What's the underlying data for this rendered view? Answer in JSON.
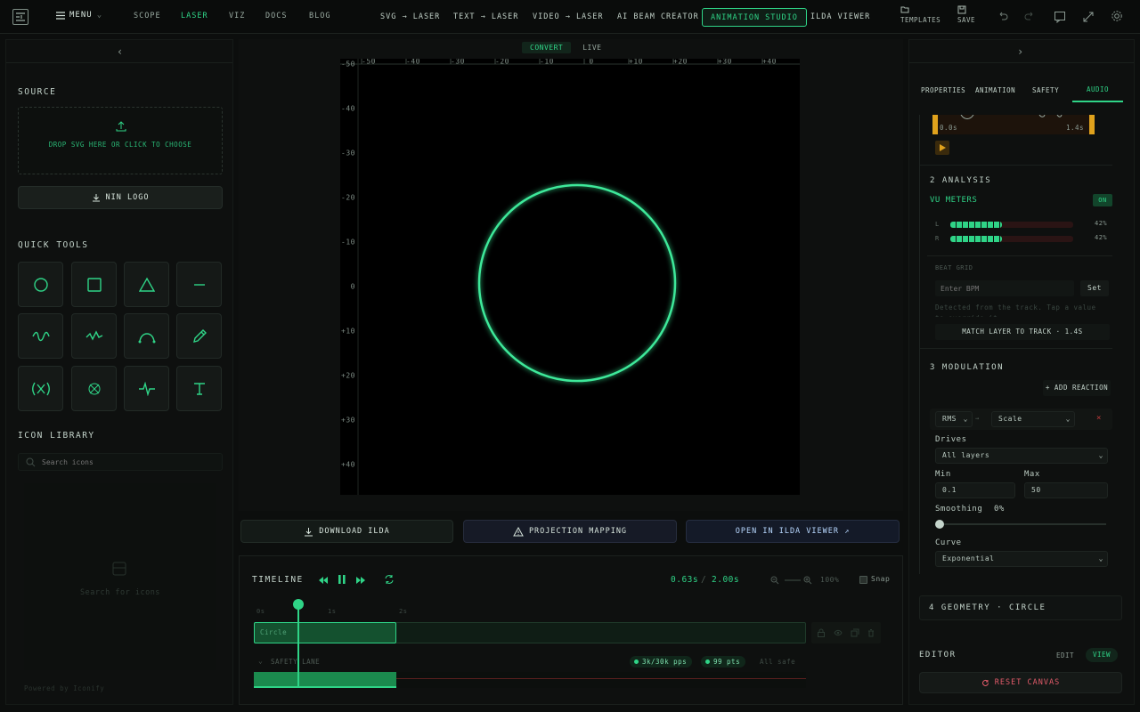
{
  "nav": {
    "menu_label": "MENU",
    "links": [
      "SCOPE",
      "LASER",
      "VIZ",
      "DOCS",
      "BLOG"
    ],
    "tabs": [
      "SVG → LASER",
      "TEXT → LASER",
      "VIDEO → LASER",
      "AI BEAM CREATOR",
      "ANIMATION STUDIO",
      "ILDA VIEWER"
    ],
    "templates_label": "TEMPLATES",
    "save_label": "SAVE"
  },
  "left": {
    "source_title": "SOURCE",
    "drop_text": "DROP SVG HERE OR CLICK TO CHOOSE",
    "nin_logo_label": "NIN LOGO",
    "quick_tools_title": "QUICK TOOLS",
    "icon_library_title": "ICON LIBRARY",
    "search_placeholder": "Search icons",
    "empty_hint": "Search for icons",
    "powered_by": "Powered by Iconify"
  },
  "canvas": {
    "modes": [
      "CONVERT",
      "LIVE"
    ],
    "x_ticks": [
      "-50",
      "-40",
      "-30",
      "-20",
      "-10",
      "0",
      "+10",
      "+20",
      "+30",
      "+40"
    ],
    "y_ticks": [
      "-50",
      "-40",
      "-30",
      "-20",
      "-10",
      "0",
      "+10",
      "+20",
      "+30",
      "+40"
    ]
  },
  "actions": {
    "download": "DOWNLOAD ILDA",
    "projection": "PROJECTION MAPPING",
    "open_viewer": "OPEN IN ILDA VIEWER ↗"
  },
  "timeline": {
    "title": "TIMELINE",
    "time": "0.63s",
    "separator": "/",
    "duration": "2.00s",
    "zoom": "100%",
    "snap_label": "Snap",
    "ruler": [
      "0s",
      "1s",
      "2s"
    ],
    "clip_label": "Circle",
    "safety_lane": "SAFETY LANE",
    "pps": "3k/30k pps",
    "pts": "99 pts",
    "all_safe": "All safe"
  },
  "right": {
    "tabs": [
      "PROPERTIES",
      "ANIMATION",
      "SAFETY",
      "AUDIO"
    ],
    "wave_start": "0.0s",
    "wave_end": "1.4s",
    "analysis_title": "2 ANALYSIS",
    "vu_title": "VU METERS",
    "vu_toggle": "ON",
    "vu_left_label": "L",
    "vu_right_label": "R",
    "vu_left_value": "42%",
    "vu_right_value": "42%",
    "vu_level": 0.42,
    "beat_grid_label": "BEAT GRID",
    "bpm_placeholder": "Enter BPM",
    "set_label": "Set",
    "detect_hint": "Detected from the track. Tap a value to override it.",
    "match_label": "MATCH LAYER TO TRACK · 1.4S",
    "modulation_title": "3 MODULATION",
    "add_reaction": "+ ADD REACTION",
    "source_value": "RMS",
    "arrow": "→",
    "target_value": "Scale",
    "drives_label": "Drives",
    "drives_value": "All layers",
    "min_label": "Min",
    "max_label": "Max",
    "min_value": "0.1",
    "max_value": "50",
    "smoothing_label": "Smoothing",
    "smoothing_value": "0%",
    "curve_label": "Curve",
    "curve_value": "Exponential",
    "geometry_title": "4 GEOMETRY · CIRCLE",
    "editor_title": "EDITOR",
    "edit_label": "EDIT",
    "view_label": "VIEW",
    "reset_label": "RESET CANVAS"
  },
  "colors": {
    "accent": "#2fd487",
    "background": "#0c0e0d",
    "warning": "#e0a21c"
  }
}
